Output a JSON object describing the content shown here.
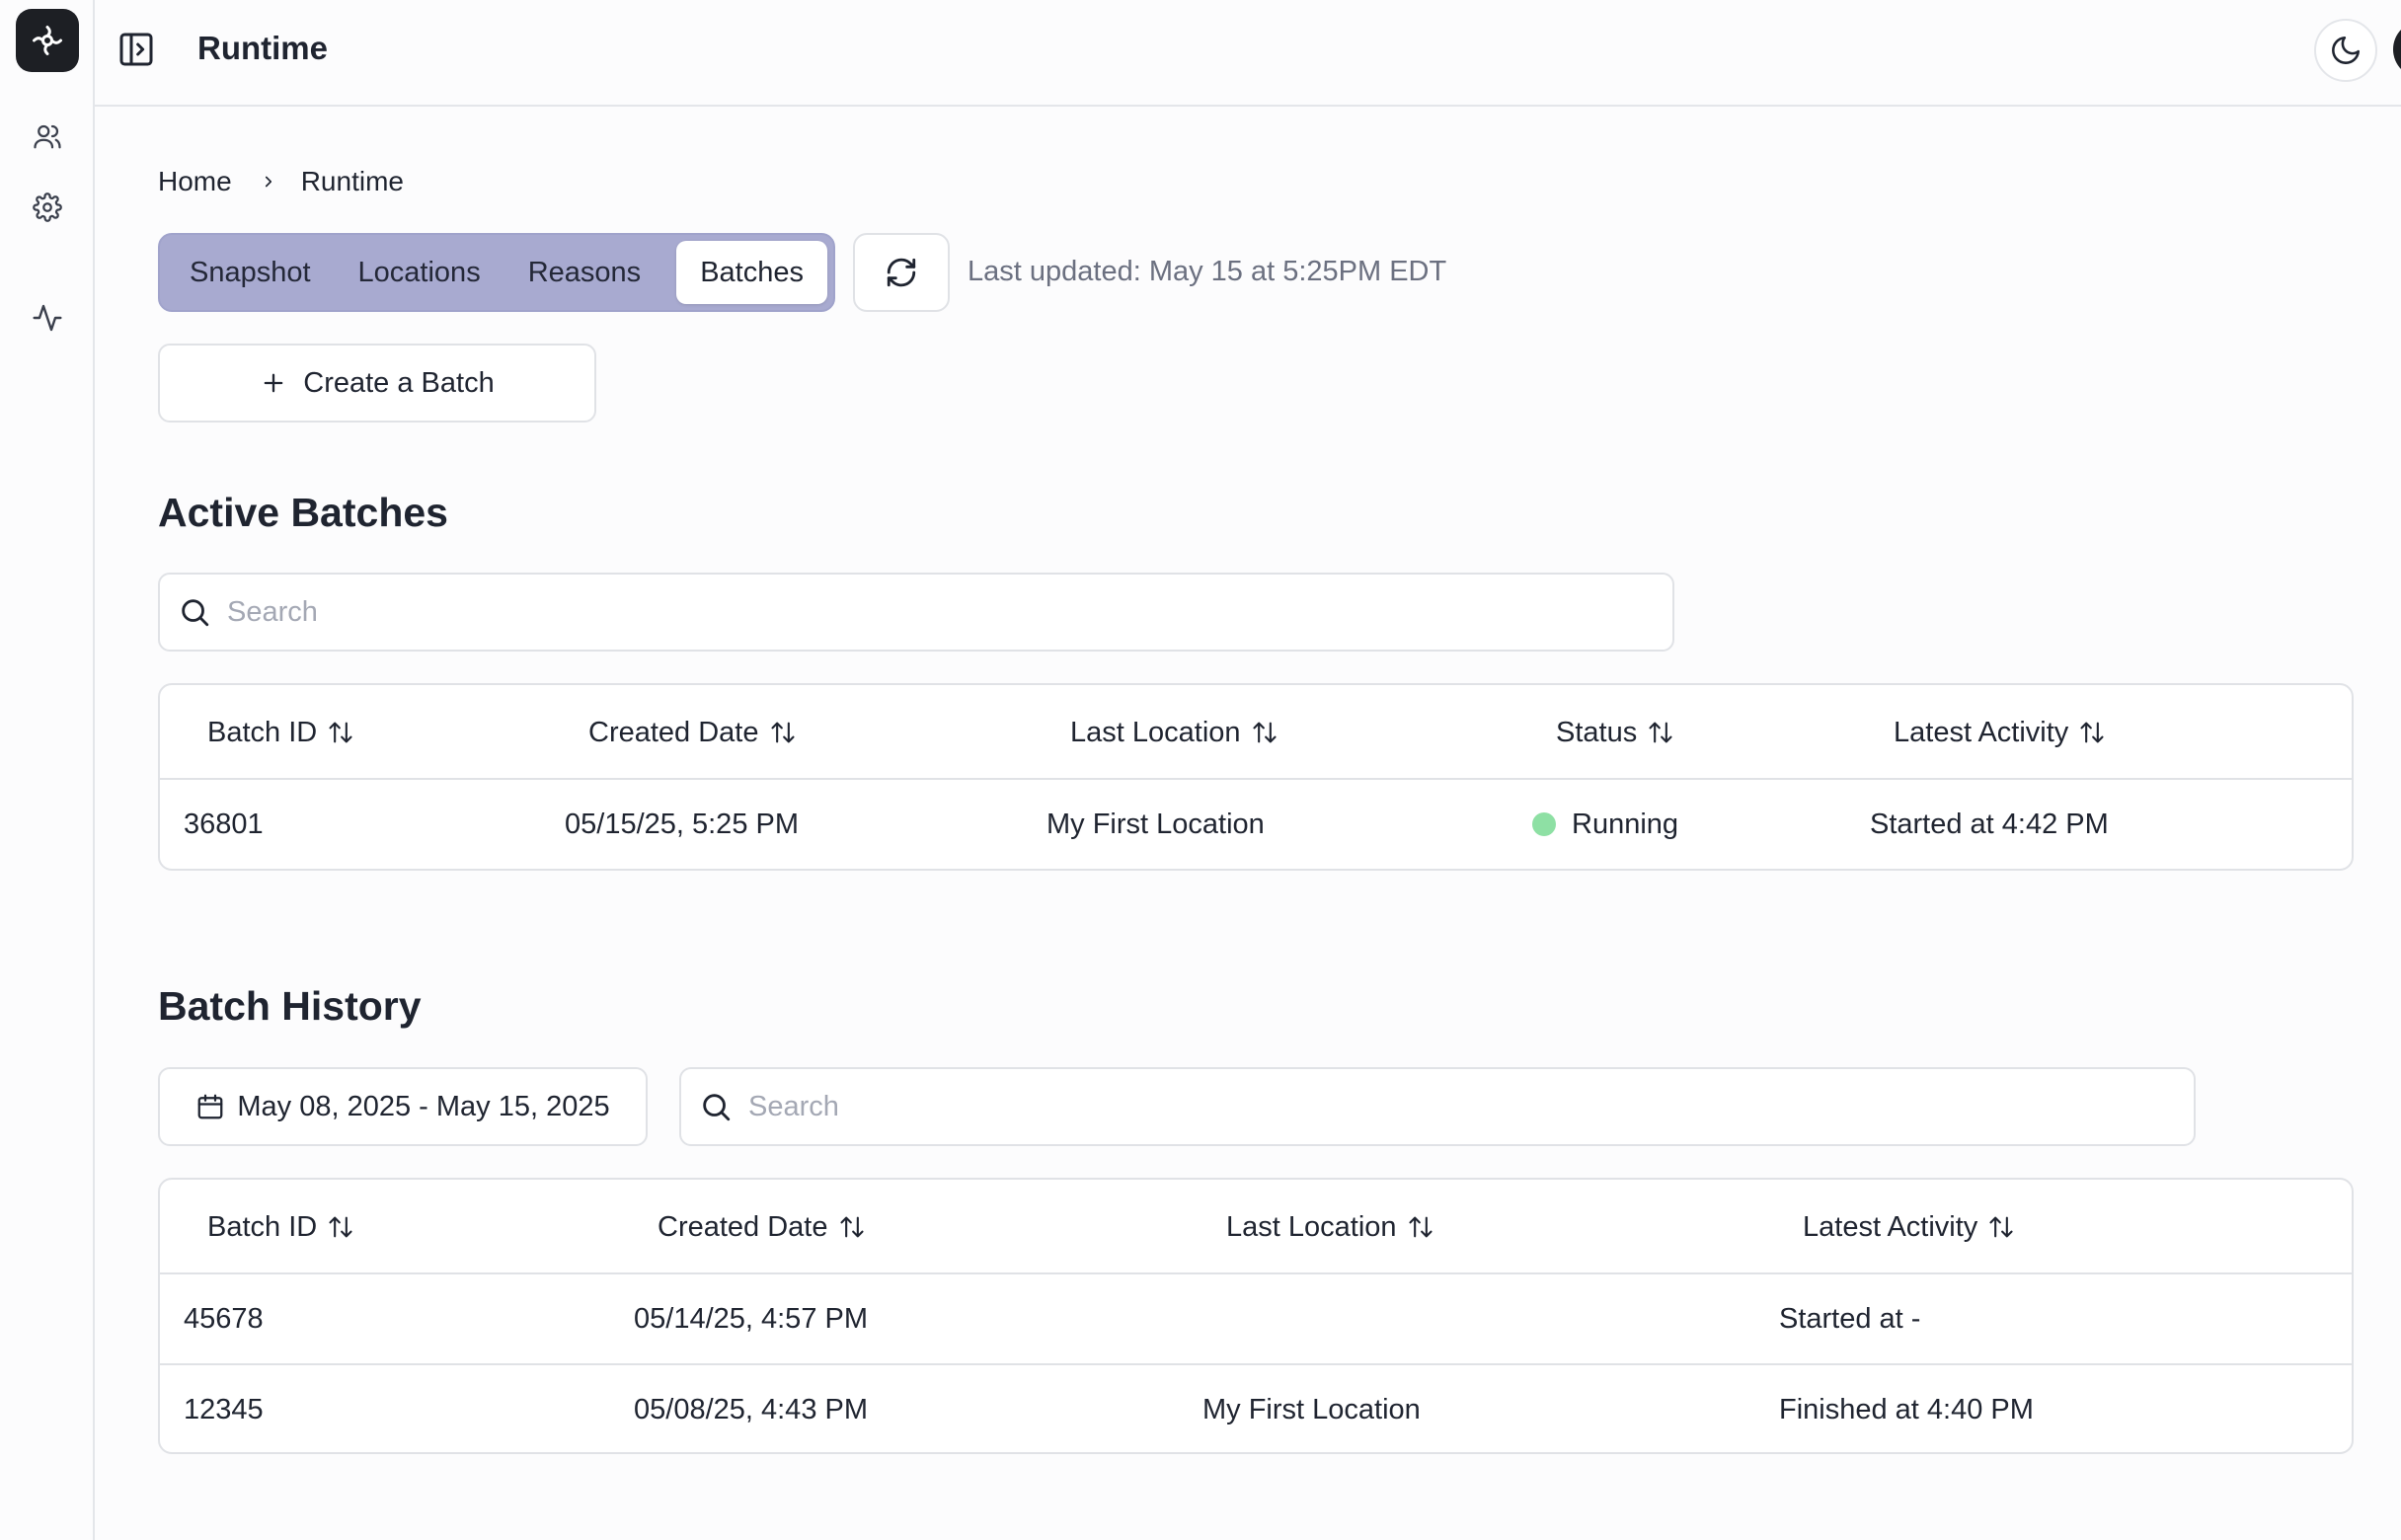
{
  "app": {
    "title": "Runtime"
  },
  "rail": {
    "icons": [
      "logo-icon",
      "users-icon",
      "settings-icon",
      "activity-icon"
    ]
  },
  "topbar": {
    "icons": [
      "sidebar-toggle-icon",
      "moon-icon",
      "user-avatar-icon"
    ]
  },
  "breadcrumb": {
    "home": "Home",
    "current": "Runtime"
  },
  "tabs": [
    {
      "label": "Snapshot",
      "active": false
    },
    {
      "label": "Locations",
      "active": false
    },
    {
      "label": "Reasons",
      "active": false
    },
    {
      "label": "Batches",
      "active": true
    }
  ],
  "last_updated": "Last updated: May 15 at 5:25PM EDT",
  "create_button": "Create a Batch",
  "active_batches": {
    "title": "Active Batches",
    "search_placeholder": "Search",
    "columns": [
      "Batch ID",
      "Created Date",
      "Last Location",
      "Status",
      "Latest Activity"
    ],
    "rows": [
      {
        "batch_id": "36801",
        "created": "05/15/25, 5:25 PM",
        "location": "My First Location",
        "status": "Running",
        "status_color": "#8ee0a4",
        "activity": "Started at 4:42 PM"
      }
    ]
  },
  "batch_history": {
    "title": "Batch History",
    "date_range": "May 08, 2025 - May 15, 2025",
    "search_placeholder": "Search",
    "columns": [
      "Batch ID",
      "Created Date",
      "Last Location",
      "Latest Activity"
    ],
    "rows": [
      {
        "batch_id": "45678",
        "created": "05/14/25, 4:57 PM",
        "location": "",
        "activity": "Started at -"
      },
      {
        "batch_id": "12345",
        "created": "05/08/25, 4:43 PM",
        "location": "My First Location",
        "activity": "Finished at 4:40 PM"
      }
    ]
  },
  "colors": {
    "accent_tabs": "#a8aad0",
    "status_running": "#8ee0a4",
    "border": "#e0e2e6"
  }
}
